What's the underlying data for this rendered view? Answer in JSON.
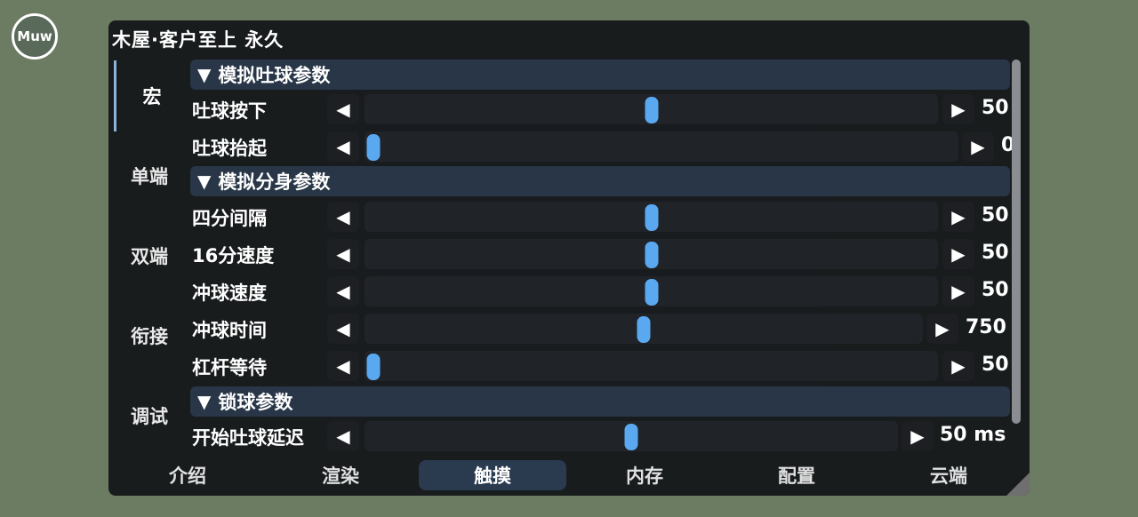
{
  "badge": "Muw",
  "window": {
    "title": "木屋·客户至上 永久"
  },
  "left_nav": [
    {
      "label": "宏",
      "active": true
    },
    {
      "label": "单端",
      "active": false
    },
    {
      "label": "双端",
      "active": false
    },
    {
      "label": "衔接",
      "active": false
    },
    {
      "label": "调试",
      "active": false
    }
  ],
  "sections": [
    {
      "title": "模拟吐球参数",
      "rows": [
        {
          "label": "吐球按下",
          "value": "50",
          "fraction": 0.5
        },
        {
          "label": "吐球抬起",
          "value": "0",
          "fraction": 0.0
        }
      ]
    },
    {
      "title": "模拟分身参数",
      "rows": [
        {
          "label": "四分间隔",
          "value": "50",
          "fraction": 0.5
        },
        {
          "label": "16分速度",
          "value": "50",
          "fraction": 0.5
        },
        {
          "label": "冲球速度",
          "value": "50",
          "fraction": 0.5
        },
        {
          "label": "冲球时间",
          "value": "750",
          "fraction": 0.5
        },
        {
          "label": "杠杆等待",
          "value": "50",
          "fraction": 0.0
        }
      ]
    },
    {
      "title": "锁球参数",
      "rows": [
        {
          "label": "开始吐球延迟",
          "value": "50 ms",
          "fraction": 0.5
        }
      ]
    }
  ],
  "icons": {
    "collapse": "triangle-down-icon",
    "decrement": "triangle-left-icon",
    "increment": "triangle-right-icon"
  },
  "bottom_tabs": [
    {
      "label": "介绍",
      "active": false
    },
    {
      "label": "渲染",
      "active": false
    },
    {
      "label": "触摸",
      "active": true
    },
    {
      "label": "内存",
      "active": false
    },
    {
      "label": "配置",
      "active": false
    },
    {
      "label": "云端",
      "active": false
    }
  ],
  "colors": {
    "accent": "#5aa9f0",
    "section_bg": "#283647",
    "panel_bg": "#121418"
  }
}
